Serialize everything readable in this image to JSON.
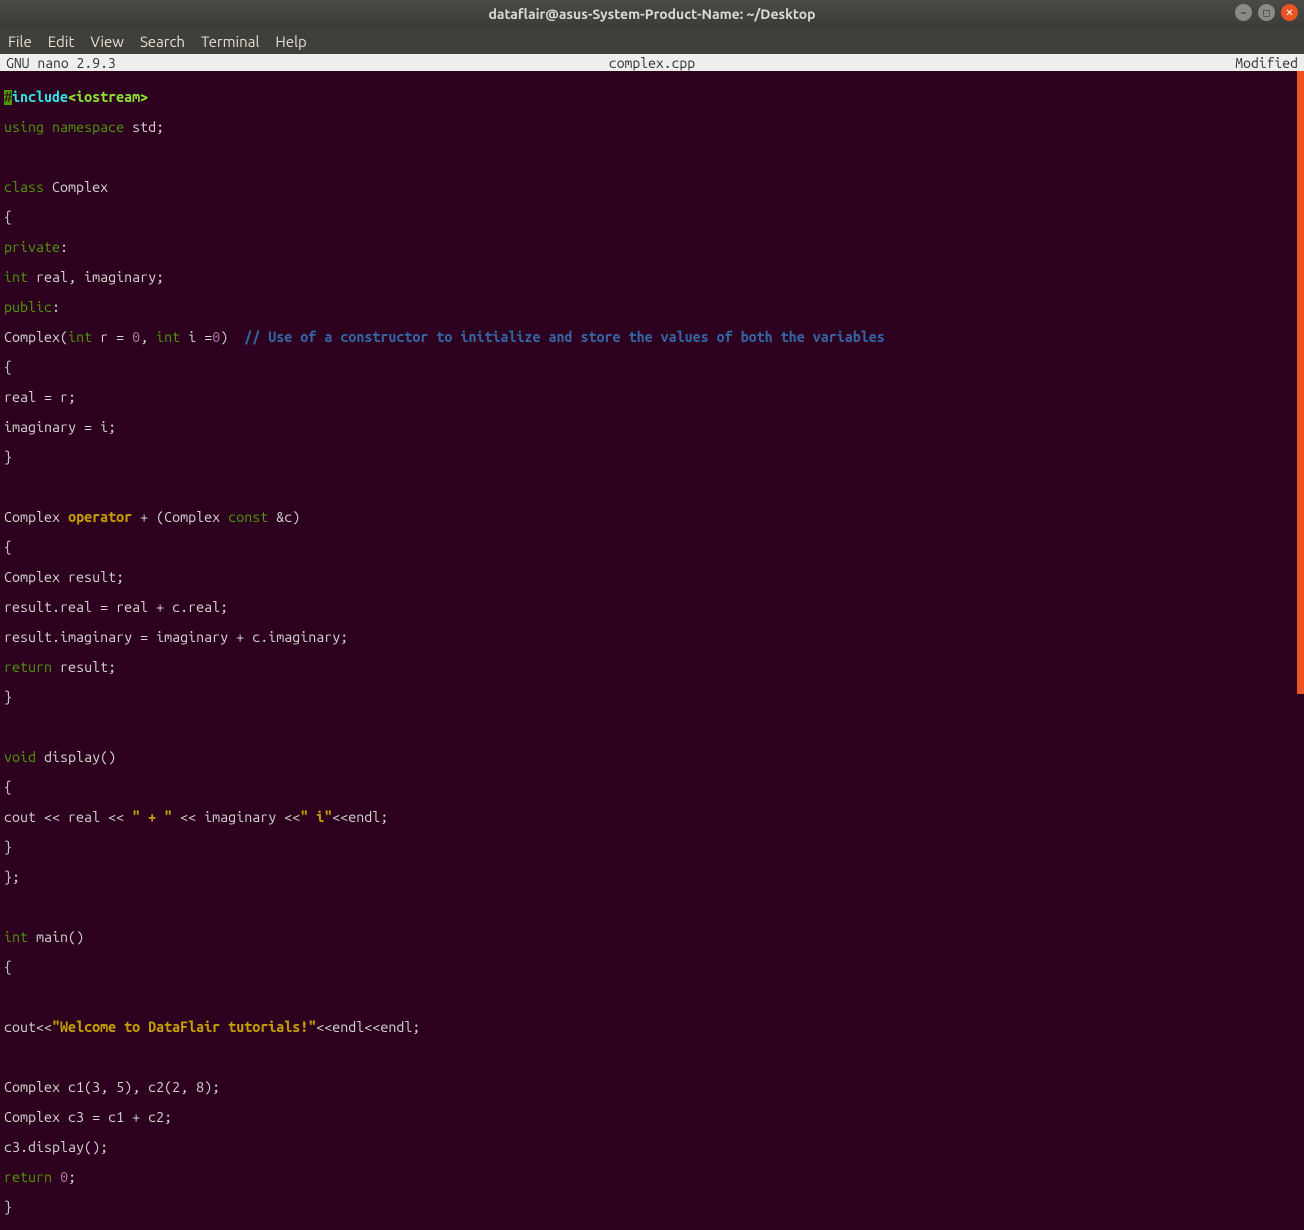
{
  "titlebar": {
    "title": "dataflair@asus-System-Product-Name: ~/Desktop"
  },
  "window_controls": {
    "minimize_glyph": "–",
    "maximize_glyph": "◻",
    "close_glyph": "✕"
  },
  "menubar": {
    "items": [
      "File",
      "Edit",
      "View",
      "Search",
      "Terminal",
      "Help"
    ]
  },
  "nanobar": {
    "left": "  GNU nano 2.9.3",
    "center": "complex.cpp",
    "right": "Modified  "
  },
  "code": {
    "l1_hash": "#",
    "l1_include": "include",
    "l1_hdr": "<iostream>",
    "l2_using": "using",
    "l2_namespace": "namespace",
    "l2_std": " std;",
    "l4_class": "class",
    "l4_name": " Complex",
    "l5": "{",
    "l6_private": "private",
    "l6_colon": ":",
    "l7_int": "int",
    "l7_rest": " real, imaginary;",
    "l8_public": "public",
    "l8_colon": ":",
    "l9_a": "Complex(",
    "l9_int1": "int",
    "l9_b": " r = ",
    "l9_z1": "0",
    "l9_c": ", ",
    "l9_int2": "int",
    "l9_d": " i =",
    "l9_z2": "0",
    "l9_e": ")  ",
    "l9_comment": "// Use of a constructor to initialize and store the values of both the variables",
    "l10": "{",
    "l11": "real = r;",
    "l12": "imaginary = i;",
    "l13": "}",
    "l15_a": "Complex ",
    "l15_op": "operator",
    "l15_b": " + (Complex ",
    "l15_const": "const",
    "l15_c": " &c)",
    "l16": "{",
    "l17": "Complex result;",
    "l18": "result.real = real + c.real;",
    "l19": "result.imaginary = imaginary + c.imaginary;",
    "l20_return": "return",
    "l20_rest": " result;",
    "l21": "}",
    "l23_void": "void",
    "l23_rest": " display()",
    "l24": "{",
    "l25_a": "cout << real << ",
    "l25_s1": "\" + \"",
    "l25_b": " << imaginary <<",
    "l25_s2": "\" i\"",
    "l25_c": "<<endl;",
    "l26": "}",
    "l27": "};",
    "l29_int": "int",
    "l29_rest": " main()",
    "l30": "{",
    "l32_a": "cout<<",
    "l32_s": "\"Welcome to DataFlair tutorials!\"",
    "l32_b": "<<endl<<endl;",
    "l34": "Complex c1(3, 5), c2(2, 8);",
    "l35": "Complex c3 = c1 + c2;",
    "l36": "c3.display();",
    "l37_return": "return",
    "l37_sp": " ",
    "l37_zero": "0",
    "l37_semi": ";",
    "l38": "}"
  }
}
